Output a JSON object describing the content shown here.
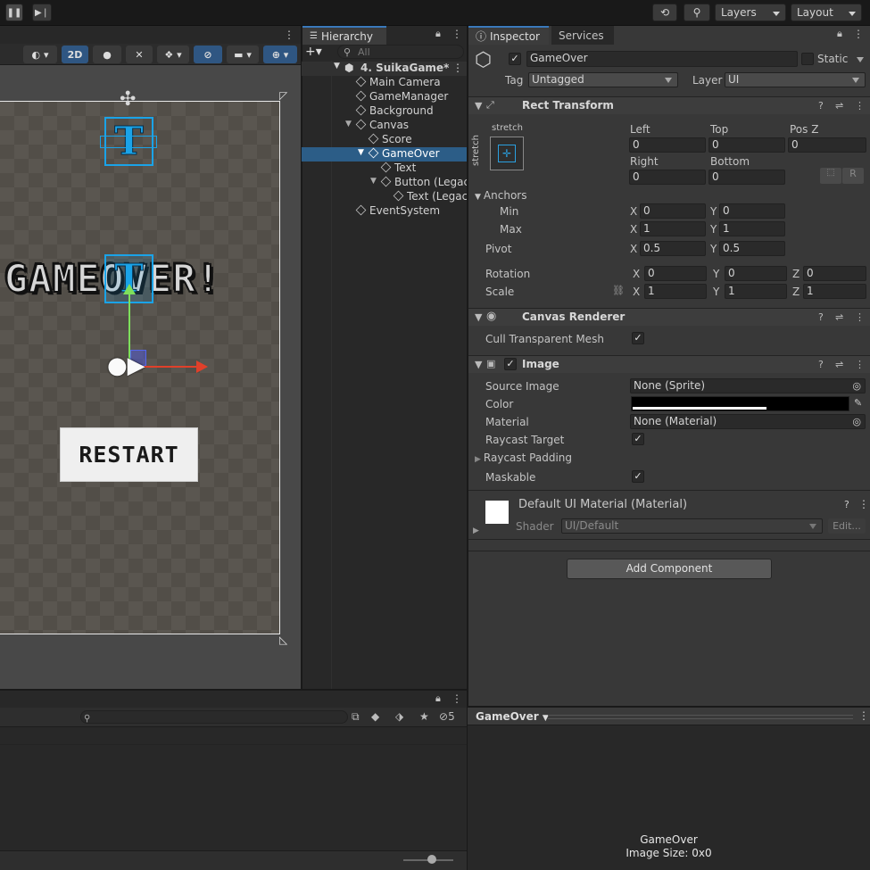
{
  "topbar": {
    "layers": "Layers",
    "layout": "Layout"
  },
  "scene": {
    "mode2d": "2D",
    "gameover": "GAMEOVER!",
    "restart": "RESTART",
    "t_glyph": "T"
  },
  "hierarchy": {
    "tab": "Hierarchy",
    "search_placeholder": "All",
    "items": [
      {
        "label": "4. SuikaGame*"
      },
      {
        "label": "Main Camera"
      },
      {
        "label": "GameManager"
      },
      {
        "label": "Background"
      },
      {
        "label": "Canvas"
      },
      {
        "label": "Score"
      },
      {
        "label": "GameOver"
      },
      {
        "label": "Text"
      },
      {
        "label": "Button (Legacy)"
      },
      {
        "label": "Text (Legacy)"
      },
      {
        "label": "EventSystem"
      }
    ]
  },
  "inspector": {
    "tab": "Inspector",
    "tab2": "Services",
    "object_name": "GameOver",
    "static_label": "Static",
    "tag_label": "Tag",
    "tag_value": "Untagged",
    "layer_label": "Layer",
    "layer_value": "UI",
    "rect": {
      "title": "Rect Transform",
      "stretch_top": "stretch",
      "stretch_side": "stretch",
      "left_label": "Left",
      "top_label": "Top",
      "posz_label": "Pos Z",
      "left": "0",
      "top": "0",
      "posz": "0",
      "right_label": "Right",
      "bottom_label": "Bottom",
      "right": "0",
      "bottom": "0",
      "r_btn": "R",
      "anchors": "Anchors",
      "min": "Min",
      "max": "Max",
      "min_x": "0",
      "min_y": "0",
      "max_x": "1",
      "max_y": "1",
      "pivot": "Pivot",
      "pivot_x": "0.5",
      "pivot_y": "0.5",
      "rotation": "Rotation",
      "rot_x": "0",
      "rot_y": "0",
      "rot_z": "0",
      "scale": "Scale",
      "scale_x": "1",
      "scale_y": "1",
      "scale_z": "1",
      "x": "X",
      "y": "Y",
      "z": "Z"
    },
    "canvas_renderer": {
      "title": "Canvas Renderer",
      "cull": "Cull Transparent Mesh"
    },
    "image": {
      "title": "Image",
      "source": "Source Image",
      "source_value": "None (Sprite)",
      "color": "Color",
      "material": "Material",
      "material_value": "None (Material)",
      "raycast_target": "Raycast Target",
      "raycast_padding": "Raycast Padding",
      "maskable": "Maskable"
    },
    "material": {
      "title": "Default UI Material (Material)",
      "shader_label": "Shader",
      "shader_value": "UI/Default",
      "edit": "Edit..."
    },
    "add_component": "Add Component"
  },
  "project": {
    "count": "5"
  },
  "preview": {
    "title": "GameOver",
    "name": "GameOver",
    "size": "Image Size: 0x0"
  }
}
